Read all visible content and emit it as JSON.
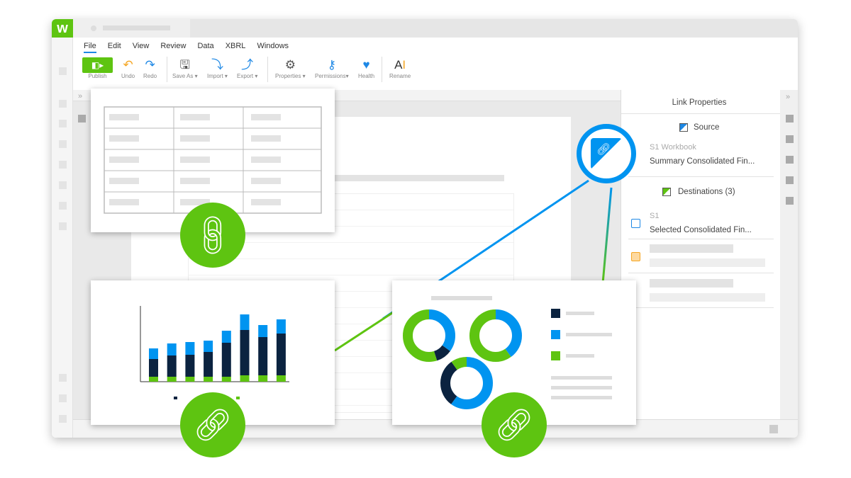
{
  "app": {
    "logo": "w"
  },
  "menu": [
    "File",
    "Edit",
    "View",
    "Review",
    "Data",
    "XBRL",
    "Windows"
  ],
  "toolbar": [
    {
      "label": "Publish",
      "icon": "publish-icon"
    },
    {
      "label": "Undo",
      "icon": "undo-icon"
    },
    {
      "label": "Redo",
      "icon": "redo-icon"
    },
    {
      "label": "Save As ▾",
      "icon": "save-as-icon"
    },
    {
      "label": "Import ▾",
      "icon": "import-icon"
    },
    {
      "label": "Export ▾",
      "icon": "export-icon"
    },
    {
      "label": "Properties ▾",
      "icon": "gear-icon"
    },
    {
      "label": "Permissions▾",
      "icon": "keys-icon"
    },
    {
      "label": "Health",
      "icon": "health-icon"
    },
    {
      "label": "Rename",
      "icon": "rename-icon"
    }
  ],
  "panel": {
    "title": "Link Properties",
    "source_label": "Source",
    "source_sub": "S1 Workbook",
    "source_name": "Summary Consolidated Fin...",
    "dest_label": "Destinations (3)",
    "dest_sub": "S1",
    "dest_name": "Selected Consolidated Fin..."
  },
  "colors": {
    "green": "#5ec411",
    "blue": "#0094f0",
    "navy": "#0b2340"
  },
  "bars": [
    {
      "dark": 25,
      "blue": 15,
      "green": 7
    },
    {
      "dark": 30,
      "blue": 17,
      "green": 7
    },
    {
      "dark": 31,
      "blue": 18,
      "green": 7
    },
    {
      "dark": 35,
      "blue": 16,
      "green": 7
    },
    {
      "dark": 48,
      "blue": 17,
      "green": 7
    },
    {
      "dark": 64,
      "blue": 22,
      "green": 9
    },
    {
      "dark": 54,
      "blue": 17,
      "green": 9
    },
    {
      "dark": 59,
      "blue": 20,
      "green": 9
    }
  ],
  "donuts": [
    {
      "navy": 0.1,
      "blue": 0.35,
      "green": 0.55
    },
    {
      "navy": 0.0,
      "blue": 0.4,
      "green": 0.6
    },
    {
      "navy": 0.3,
      "blue": 0.6,
      "green": 0.1
    }
  ]
}
